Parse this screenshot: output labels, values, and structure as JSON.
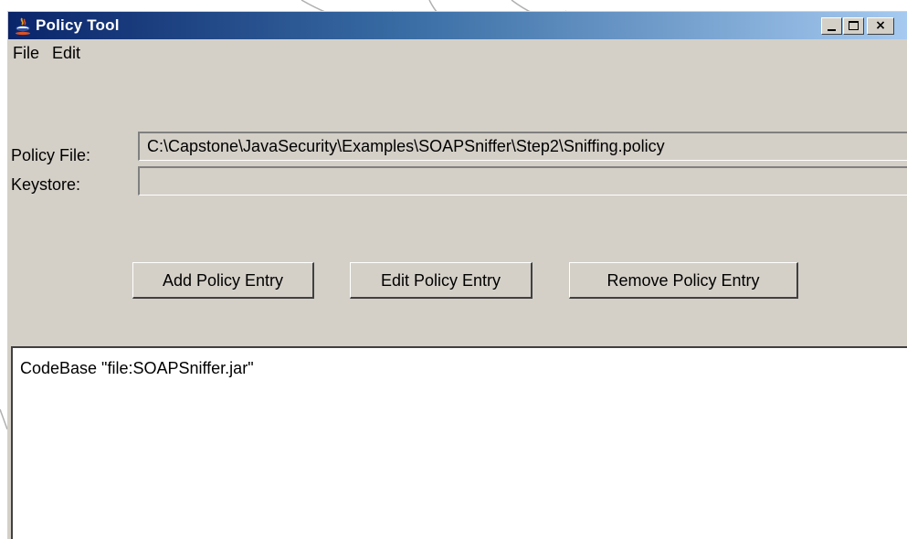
{
  "window": {
    "title": "Policy Tool",
    "icon": "java-cup-icon",
    "controls": {
      "minimize": "_",
      "maximize": "□",
      "close": "×"
    }
  },
  "menubar": {
    "items": [
      "File",
      "Edit"
    ]
  },
  "form": {
    "policy_file_label": "Policy File:",
    "policy_file_value": "C:\\Capstone\\JavaSecurity\\Examples\\SOAPSniffer\\Step2\\Sniffing.policy",
    "keystore_label": "Keystore:",
    "keystore_value": ""
  },
  "buttons": {
    "add": "Add Policy Entry",
    "edit": "Edit Policy Entry",
    "remove": "Remove Policy Entry"
  },
  "entries": [
    "CodeBase \"file:SOAPSniffer.jar\""
  ],
  "colors": {
    "titlebar_start": "#0a246a",
    "titlebar_end": "#a6caf0",
    "window_bg": "#d4d0c8",
    "list_bg": "#ffffff"
  }
}
